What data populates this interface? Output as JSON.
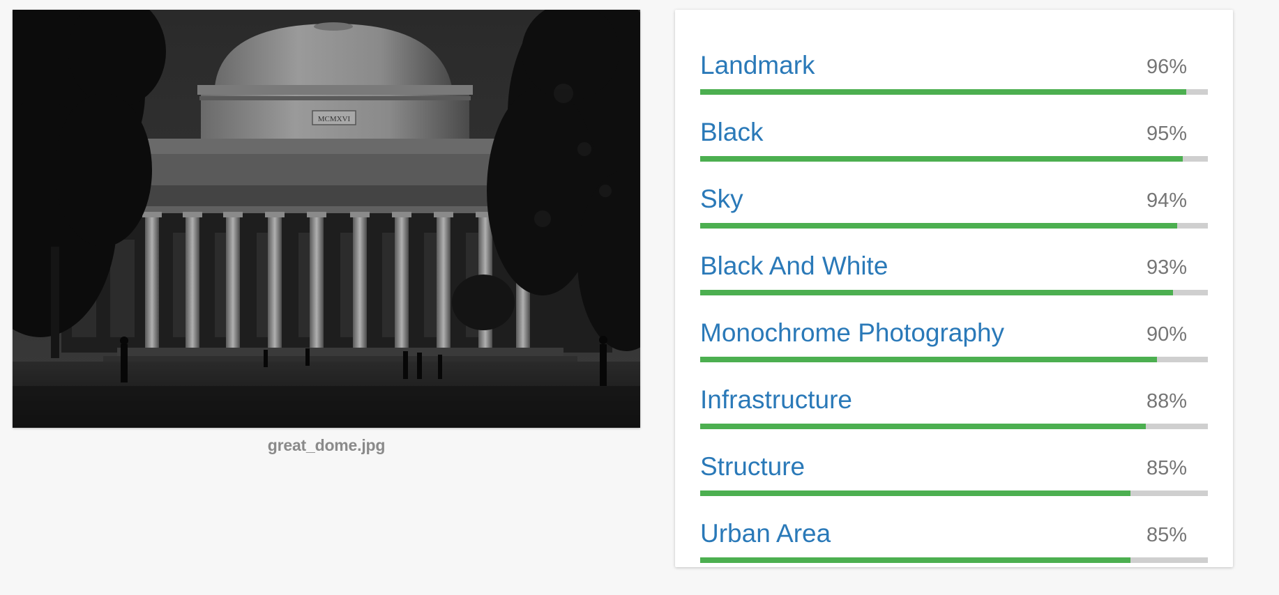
{
  "image": {
    "filename": "great_dome.jpg",
    "inscription": "MCMXVI"
  },
  "labels": [
    {
      "name": "Landmark",
      "score_text": "96%",
      "score": 0.96,
      "bar_fill": 0.958
    },
    {
      "name": "Black",
      "score_text": "95%",
      "score": 0.95,
      "bar_fill": 0.951
    },
    {
      "name": "Sky",
      "score_text": "94%",
      "score": 0.94,
      "bar_fill": 0.94
    },
    {
      "name": "Black And White",
      "score_text": "93%",
      "score": 0.93,
      "bar_fill": 0.931
    },
    {
      "name": "Monochrome Photography",
      "score_text": "90%",
      "score": 0.9,
      "bar_fill": 0.9
    },
    {
      "name": "Infrastructure",
      "score_text": "88%",
      "score": 0.88,
      "bar_fill": 0.878
    },
    {
      "name": "Structure",
      "score_text": "85%",
      "score": 0.85,
      "bar_fill": 0.848
    },
    {
      "name": "Urban Area",
      "score_text": "85%",
      "score": 0.85,
      "bar_fill": 0.848
    }
  ],
  "colors": {
    "label_text": "#2a79b8",
    "score_text": "#757575",
    "bar_fill": "#4caf50",
    "bar_track": "#cfcfcf",
    "background": "#f7f7f7"
  }
}
